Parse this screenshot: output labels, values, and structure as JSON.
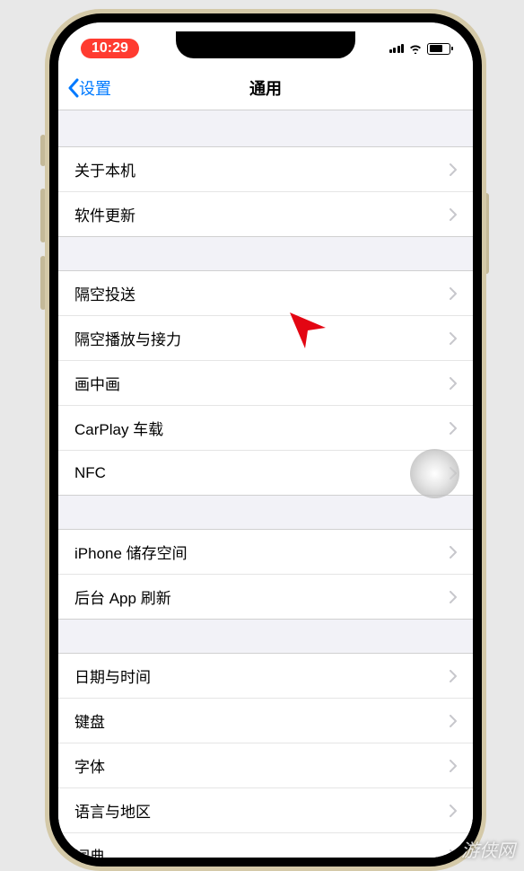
{
  "status": {
    "time": "10:29"
  },
  "nav": {
    "back": "设置",
    "title": "通用"
  },
  "groups": [
    {
      "rows": [
        {
          "label": "关于本机"
        },
        {
          "label": "软件更新"
        }
      ]
    },
    {
      "rows": [
        {
          "label": "隔空投送"
        },
        {
          "label": "隔空播放与接力"
        },
        {
          "label": "画中画"
        },
        {
          "label": "CarPlay 车载"
        },
        {
          "label": "NFC"
        }
      ]
    },
    {
      "rows": [
        {
          "label": "iPhone 储存空间"
        },
        {
          "label": "后台 App 刷新"
        }
      ]
    },
    {
      "rows": [
        {
          "label": "日期与时间"
        },
        {
          "label": "键盘"
        },
        {
          "label": "字体"
        },
        {
          "label": "语言与地区"
        },
        {
          "label": "词典"
        }
      ]
    }
  ],
  "watermark": "游侠网"
}
